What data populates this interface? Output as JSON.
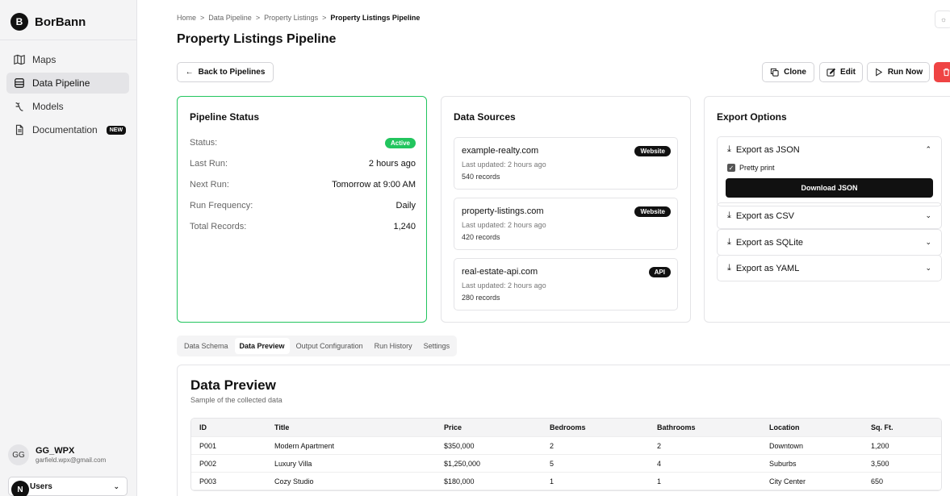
{
  "app": {
    "brand_initial": "B",
    "brand_name": "BorBann"
  },
  "sidebar": {
    "items": [
      {
        "label": "Maps",
        "icon": "map-icon"
      },
      {
        "label": "Data Pipeline",
        "icon": "database-icon"
      },
      {
        "label": "Models",
        "icon": "models-icon"
      },
      {
        "label": "Documentation",
        "icon": "document-icon",
        "badge": "NEW"
      }
    ],
    "user": {
      "initials": "GG",
      "name": "GG_WPX",
      "email": "garfield.wpx@gmail.com"
    },
    "workspace": {
      "avatar": "N",
      "label": "Users"
    }
  },
  "breadcrumb": [
    "Home",
    "Data Pipeline",
    "Property Listings",
    "Property Listings Pipeline"
  ],
  "page_title": "Property Listings Pipeline",
  "actions": {
    "back": "Back to Pipelines",
    "clone": "Clone",
    "edit": "Edit",
    "run": "Run Now"
  },
  "status_card": {
    "title": "Pipeline Status",
    "rows": [
      {
        "label": "Status:",
        "value": "Active"
      },
      {
        "label": "Last Run:",
        "value": "2 hours ago"
      },
      {
        "label": "Next Run:",
        "value": "Tomorrow at 9:00 AM"
      },
      {
        "label": "Run Frequency:",
        "value": "Daily"
      },
      {
        "label": "Total Records:",
        "value": "1,240"
      }
    ]
  },
  "sources_card": {
    "title": "Data Sources",
    "sources": [
      {
        "name": "example-realty.com",
        "updated": "Last updated: 2 hours ago",
        "records": "540 records",
        "type": "Website"
      },
      {
        "name": "property-listings.com",
        "updated": "Last updated: 2 hours ago",
        "records": "420 records",
        "type": "Website"
      },
      {
        "name": "real-estate-api.com",
        "updated": "Last updated: 2 hours ago",
        "records": "280 records",
        "type": "API"
      }
    ]
  },
  "export_card": {
    "title": "Export Options",
    "json": {
      "label": "Export as JSON",
      "pretty": "Pretty print",
      "download": "Download JSON"
    },
    "others": [
      "Export as CSV",
      "Export as SQLite",
      "Export as YAML"
    ]
  },
  "tabs": [
    "Data Schema",
    "Data Preview",
    "Output Configuration",
    "Run History",
    "Settings"
  ],
  "preview": {
    "title": "Data Preview",
    "subtitle": "Sample of the collected data",
    "columns": [
      "ID",
      "Title",
      "Price",
      "Bedrooms",
      "Bathrooms",
      "Location",
      "Sq. Ft."
    ],
    "rows": [
      [
        "P001",
        "Modern Apartment",
        "$350,000",
        "2",
        "2",
        "Downtown",
        "1,200"
      ],
      [
        "P002",
        "Luxury Villa",
        "$1,250,000",
        "5",
        "4",
        "Suburbs",
        "3,500"
      ],
      [
        "P003",
        "Cozy Studio",
        "$180,000",
        "1",
        "1",
        "City Center",
        "650"
      ]
    ]
  }
}
